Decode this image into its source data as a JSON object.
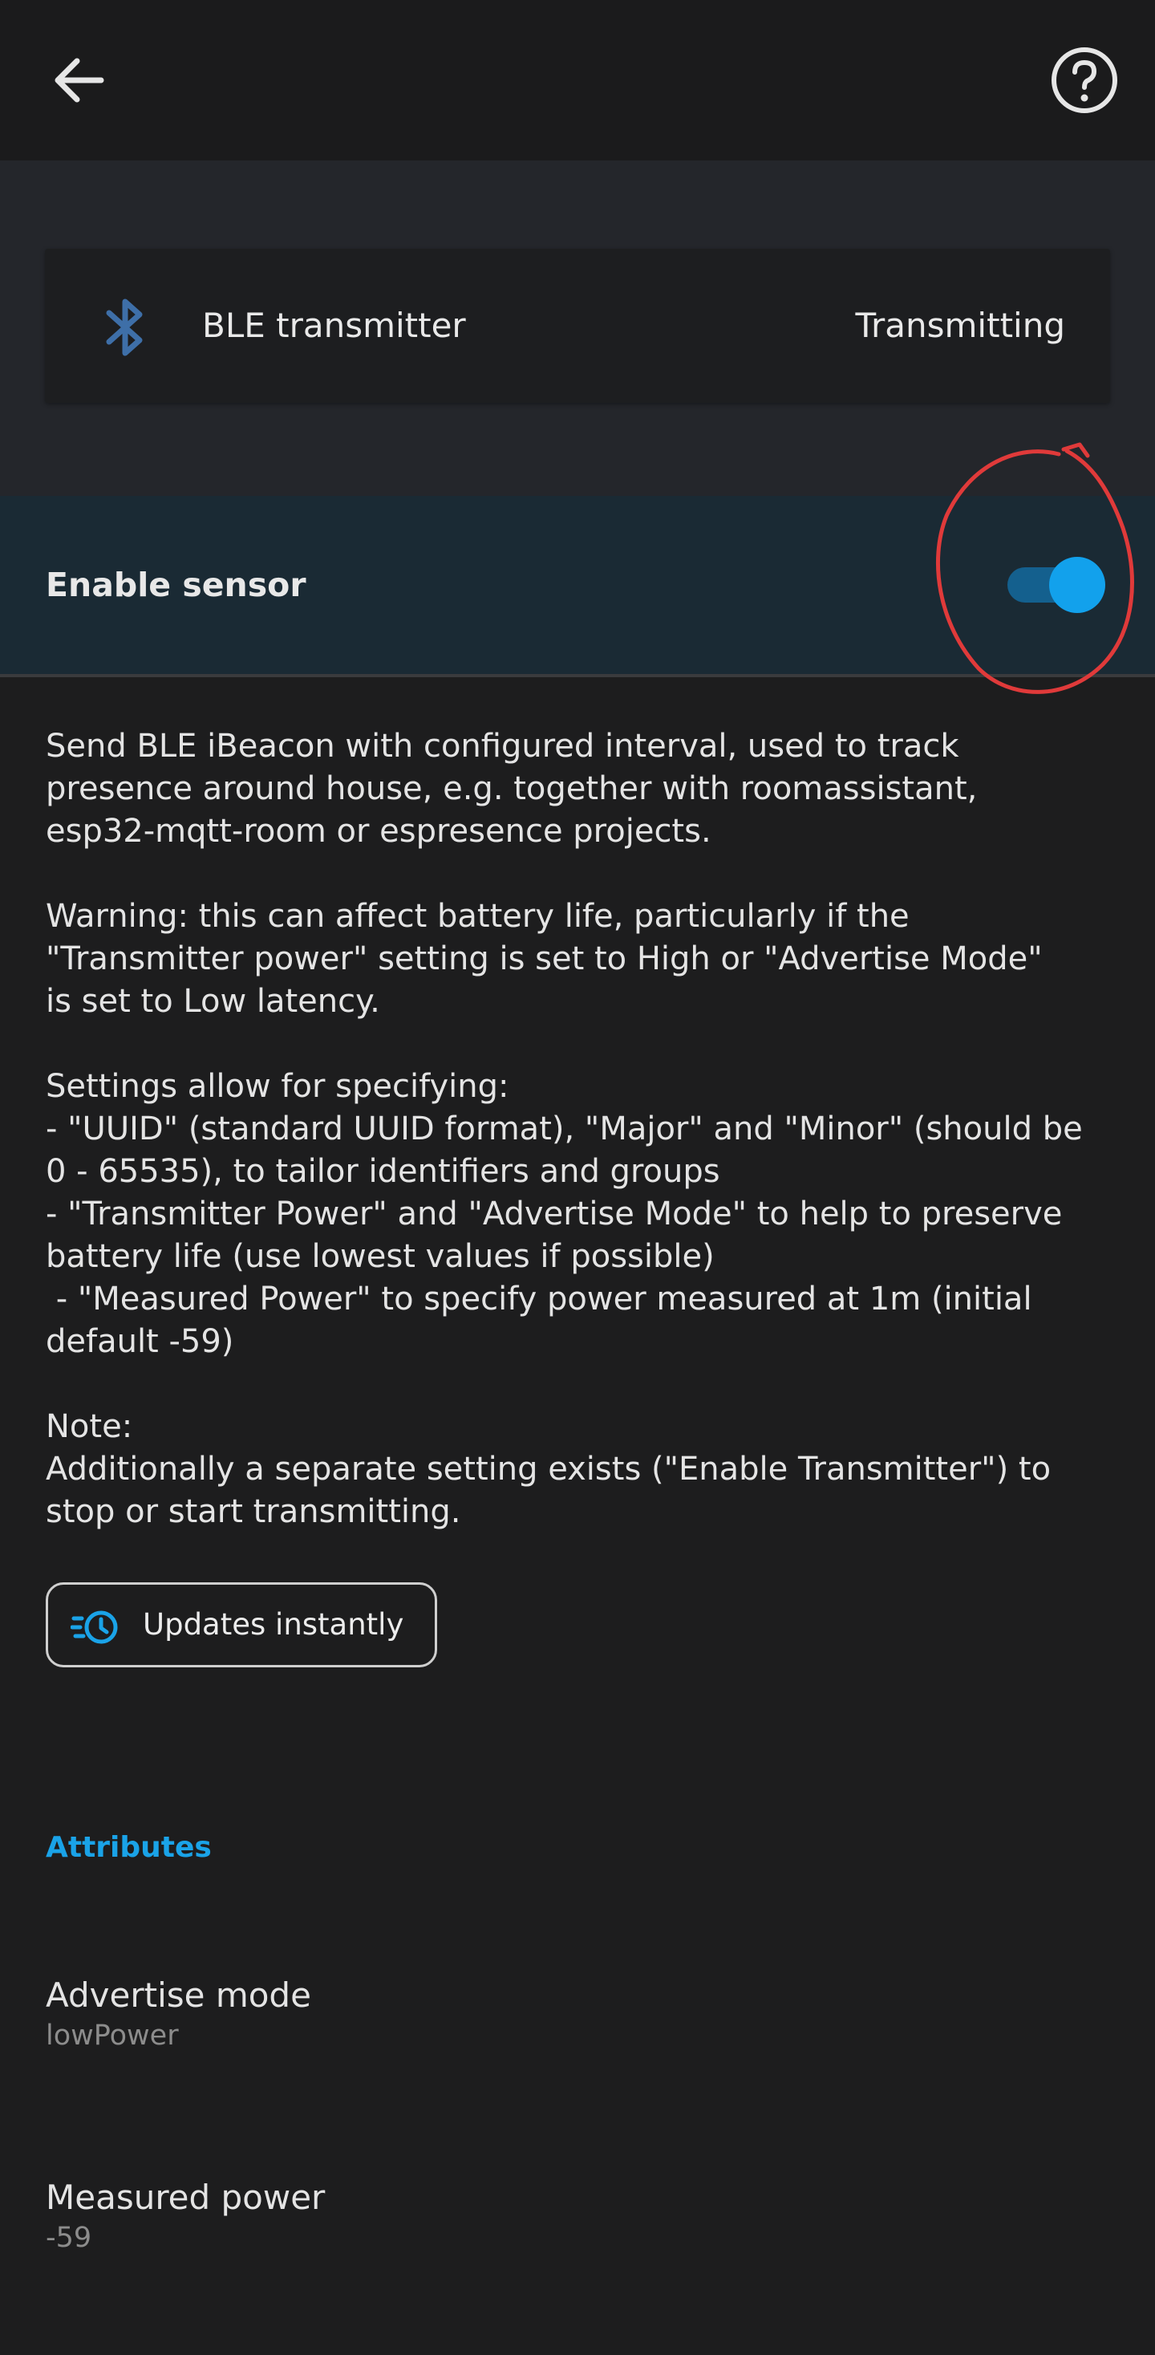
{
  "appbar": {
    "back_icon": "arrow-left-icon",
    "help_icon": "question-circle-icon"
  },
  "status": {
    "icon": "bluetooth-icon",
    "title": "BLE transmitter",
    "value": "Transmitting"
  },
  "enable": {
    "label": "Enable sensor",
    "on": true,
    "accent": "#12a1ec"
  },
  "description": "Send BLE iBeacon with configured interval, used to track\npresence around house, e.g. together with roomassistant,\nesp32-mqtt-room or espresence projects.\n\nWarning: this can affect battery life, particularly if the\n\"Transmitter power\" setting is set to High or \"Advertise Mode\"\nis set to Low latency.\n\nSettings allow for specifying:\n- \"UUID\" (standard UUID format), \"Major\" and \"Minor\" (should be\n0 - 65535), to tailor identifiers and groups\n- \"Transmitter Power\" and \"Advertise Mode\" to help to preserve\nbattery life (use lowest values if possible)\n - \"Measured Power\" to specify power measured at 1m (initial\ndefault -59)\n\nNote:\nAdditionally a separate setting exists (\"Enable Transmitter\") to\nstop or start transmitting.",
  "chip": {
    "icon": "clock-update-icon",
    "label": "Updates instantly"
  },
  "attributes": {
    "header": "Attributes",
    "items": [
      {
        "name": "Advertise mode",
        "value": "lowPower"
      },
      {
        "name": "Measured power",
        "value": "-59"
      }
    ]
  },
  "colors": {
    "background": "#1d1d1e",
    "accent": "#1aa3e8",
    "annotation": "#e03a3a"
  }
}
